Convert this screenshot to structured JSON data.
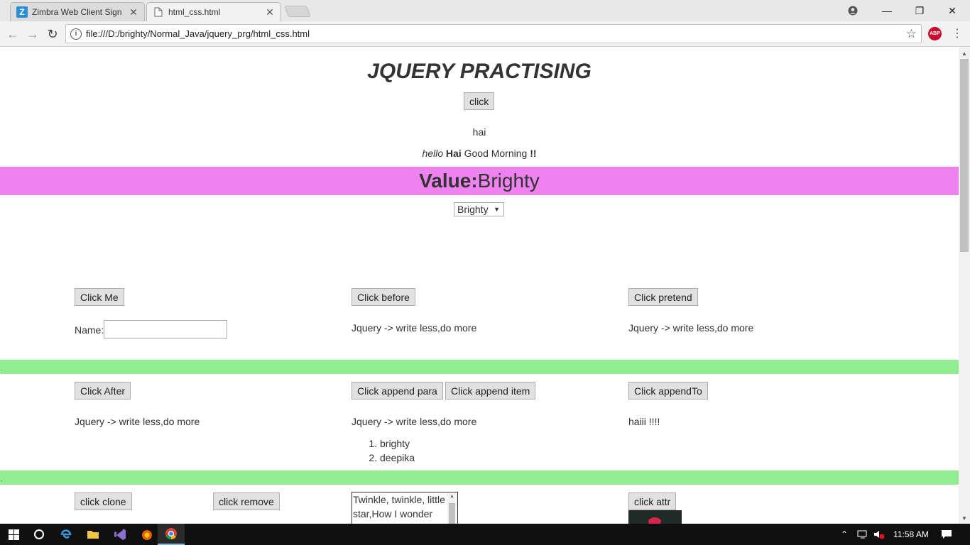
{
  "browser": {
    "tabs": [
      {
        "title": "Zimbra Web Client Sign I",
        "active": false,
        "favicon": "zimbra-icon"
      },
      {
        "title": "html_css.html",
        "active": true,
        "favicon": "page-icon"
      }
    ],
    "url": "file:///D:/brighty/Normal_Java/jquery_prg/html_css.html",
    "abp_label": "ABP"
  },
  "page": {
    "heading": "JQUERY PRACTISING",
    "click_button": "click",
    "hai_text": "hai",
    "greeting": {
      "hello": "hello",
      "hai": "Hai",
      "rest": "Good Morning",
      "bang": "!!"
    },
    "value_bar": {
      "label": "Value:",
      "value": "Brighty",
      "color": "#ee82ee"
    },
    "select_value": "Brighty",
    "section1": {
      "click_me": "Click Me",
      "name_label": "Name:",
      "click_before": "Click before",
      "before_text": "Jquery -> write less,do more",
      "click_pretend": "Click pretend",
      "pretend_text": "Jquery -> write less,do more"
    },
    "divider_color": "#90ee90",
    "section2": {
      "click_after": "Click After",
      "after_text": "Jquery -> write less,do more",
      "click_append_para": "Click append para",
      "click_append_item": "Click append item",
      "append_text": "Jquery -> write less,do more",
      "list_items": [
        "brighty",
        "deepika"
      ],
      "click_appendto": "Click appendTo",
      "appendto_text": "haiii !!!!"
    },
    "section3": {
      "click_clone": "click clone",
      "click_remove": "click remove",
      "textarea_value": "Twinkle, twinkle, little star,How I wonder",
      "click_attr": "click attr"
    }
  },
  "taskbar": {
    "time": "11:58 AM"
  }
}
